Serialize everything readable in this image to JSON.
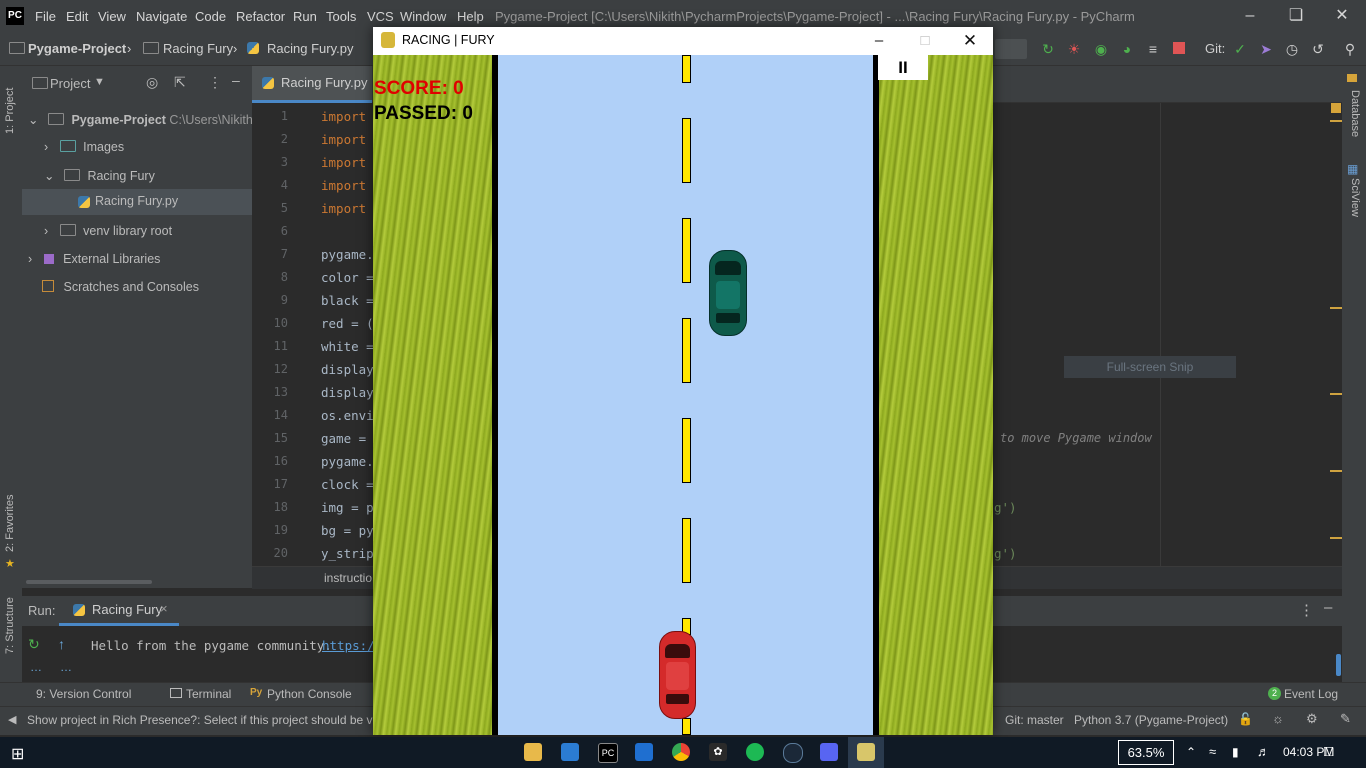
{
  "ide": {
    "logo_text": "PC",
    "menu": [
      "File",
      "Edit",
      "View",
      "Navigate",
      "Code",
      "Refactor",
      "Run",
      "Tools",
      "VCS",
      "Window",
      "Help"
    ],
    "window_caption": "Pygame-Project [C:\\Users\\Nikith\\PycharmProjects\\Pygame-Project] - ...\\Racing Fury\\Racing Fury.py - PyCharm",
    "breadcrumbs": [
      "Pygame-Project",
      "Racing Fury",
      "Racing Fury.py"
    ],
    "git_label": "Git:",
    "project_tab": "Project",
    "tree": {
      "root_name": "Pygame-Project",
      "root_path": "C:\\Users\\Nikith\\Py",
      "images": "Images",
      "racing_fury": "Racing Fury",
      "file": "Racing Fury.py",
      "venv": "venv library root",
      "external": "External Libraries",
      "scratches": "Scratches and Consoles"
    },
    "editor_tab": "Racing Fury.py",
    "line_numbers": [
      "1",
      "2",
      "3",
      "4",
      "5",
      "6",
      "7",
      "8",
      "9",
      "10",
      "11",
      "12",
      "13",
      "14",
      "15",
      "16",
      "17",
      "18",
      "19",
      "20"
    ],
    "code_lines": [
      "import",
      "import",
      "import",
      "import",
      "import",
      "",
      "pygame.",
      "color =",
      "black =",
      "red = (",
      "white =",
      "display_",
      "display_",
      "os.envir",
      "game = ",
      "pygame.",
      "clock =",
      "img = py",
      "bg = pyg",
      "y_strip"
    ],
    "comment_fragment": "to move Pygame window",
    "str_line18": "g')",
    "str_line20": "g')",
    "snip_label": "Full-screen Snip",
    "bottom_tab_fragment": "instructio",
    "left_tabs": {
      "project": "1: Project",
      "favorites": "2: Favorites",
      "structure": "7: Structure"
    },
    "right_tabs": {
      "database": "Database",
      "sciview": "SciView"
    },
    "run": {
      "label": "Run:",
      "tab": "Racing Fury",
      "console_text": "Hello from the pygame community.",
      "console_link": "https:/"
    },
    "tool_tabs": [
      "9: Version Control",
      "Terminal",
      "Python Console"
    ],
    "event_log": "Event Log",
    "event_count": "2",
    "status_msg": "Show project in Rich Presence?: Select if this project should be visi",
    "git_branch": "Git: master",
    "interpreter": "Python 3.7 (Pygame-Project)"
  },
  "game": {
    "title": "RACING | FURY",
    "score": "SCORE: 0",
    "passed": "PASSED: 0",
    "pause_symbol": "II",
    "colors": {
      "road": "#b0d0f8",
      "strip": "#ffe600",
      "player_car": "#d42a2a",
      "enemy_car": "#0e5a4a"
    }
  },
  "taskbar": {
    "battery": "63.5%",
    "time": "04:03 PM"
  }
}
